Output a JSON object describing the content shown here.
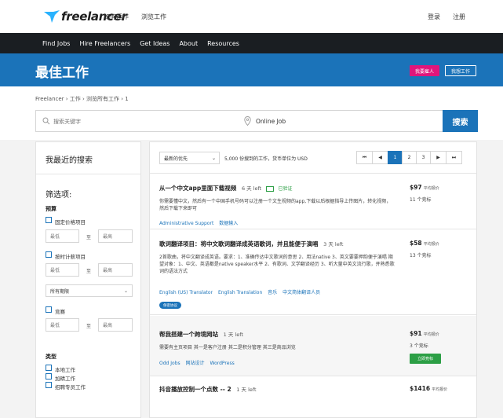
{
  "header": {
    "logo_text": "freelancer",
    "how_it_works": "如何运作",
    "browse_jobs": "浏览工作",
    "login": "登录",
    "register": "注册"
  },
  "nav": {
    "items": [
      "Find Jobs",
      "Hire Freelancers",
      "Get Ideas",
      "About",
      "Resources"
    ]
  },
  "hero": {
    "title": "最佳工作",
    "hire_button": "我要雇人",
    "find_button": "我想工作"
  },
  "breadcrumb": "Freelancer  ›  工作  ›  浏览所有工作  ›  1",
  "search": {
    "keyword_placeholder": "搜索关键字",
    "location_value": "Online Job",
    "button": "搜索"
  },
  "sidebar": {
    "recent_title": "我最近的搜索",
    "filter_title": "筛选项:",
    "budget_label": "预算",
    "fixed_price": "固定价格项目",
    "min": "最低",
    "to": "至",
    "max": "最高",
    "hourly": "按时计薪项目",
    "duration_select": "所有期限",
    "contest": "竞赛",
    "type_label": "类型",
    "local_jobs": "本地工作",
    "featured_jobs": "加精工作",
    "recruiter_jobs": "招聘专员工作"
  },
  "toolbar": {
    "sort_select": "最新的优先",
    "count_text": "5,000 份搜到的工作，货币单位为 USD",
    "pages": [
      "⏮",
      "◀",
      "1",
      "2",
      "3",
      "▶",
      "⏭"
    ]
  },
  "jobs": [
    {
      "title": "从一个中文app里面下载视频",
      "time": "6 天 left",
      "verified": "已验证",
      "desc": "你需要懂中文，然后有一个中国手机号码可以注册一个文生视频的app,下载以后根据指导上传图片，转化视频，然后下载下来即可",
      "tags": [
        "Administrative Support",
        "数据输入"
      ],
      "price": "$97",
      "price_sub": "平均报价",
      "bids": "11 个竞标"
    },
    {
      "title": "歌词翻译项目：将中文歌词翻译成英语歌词，并且能便于演唱",
      "time": "3 天 left",
      "desc": "2首歌曲，将中文翻译成英语。要求：1、准确传达中文歌词的意思 2、用法native 3、英文要要押韵便于演唱 期望对象：1、中文、英语都是native speaker水平 2、有歌词、文学翻译经历 3、听大量中英文流行歌，并熟悉歌词的语法方式",
      "tags": [
        "English (US) Translator",
        "English Translation",
        "音乐",
        "中文简体翻译人员"
      ],
      "pill": "保密协议",
      "price": "$58",
      "price_sub": "平均报价",
      "bids": "13 个竞标"
    },
    {
      "title": "帮我搭建一个跨境网站",
      "time": "1 天 left",
      "desc": "需要有主页项目 其一是客户注册 其二是积分管理 其三是商品浏览",
      "tags": [
        "Odd Jobs",
        "网站设计",
        "WordPress"
      ],
      "price": "$91",
      "price_sub": "平均报价",
      "bids": "3 个竞标",
      "bid_button": "立即竞标"
    },
    {
      "title": "抖音播放控制一个点数 -- 2",
      "time": "1 天 left",
      "price": "$1416",
      "price_sub": "平均报价"
    }
  ],
  "colors": {
    "brand_blue": "#1b73b9",
    "hire_pink": "#e0167b",
    "nav_dark": "#1a1e22",
    "bid_green": "#2c9f45"
  }
}
